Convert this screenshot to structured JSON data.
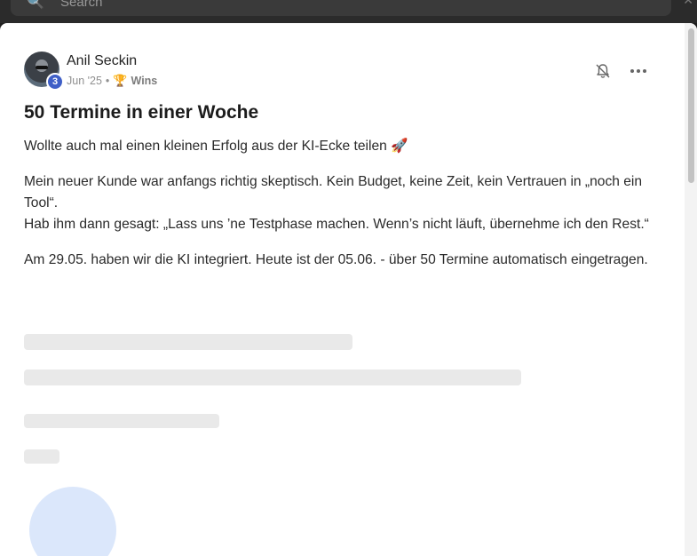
{
  "search": {
    "placeholder": "Search"
  },
  "post": {
    "author": "Anil Seckin",
    "level": "3",
    "date": "Jun '25",
    "separator": "•",
    "category": "Wins",
    "title": "50 Termine in einer Woche",
    "paragraphs": [
      "Wollte auch mal einen kleinen Erfolg aus der KI-Ecke teilen 🚀",
      "Mein neuer Kunde war anfangs richtig skeptisch. Kein Budget, keine Zeit, kein Vertrauen in „noch ein Tool“.",
      "Hab ihm dann gesagt: „Lass uns ’ne Testphase machen. Wenn’s nicht läuft, übernehme ich den Rest.“",
      "Am 29.05. haben wir die KI integriert. Heute ist der 05.06. - über 50 Termine automatisch eingetragen."
    ]
  }
}
